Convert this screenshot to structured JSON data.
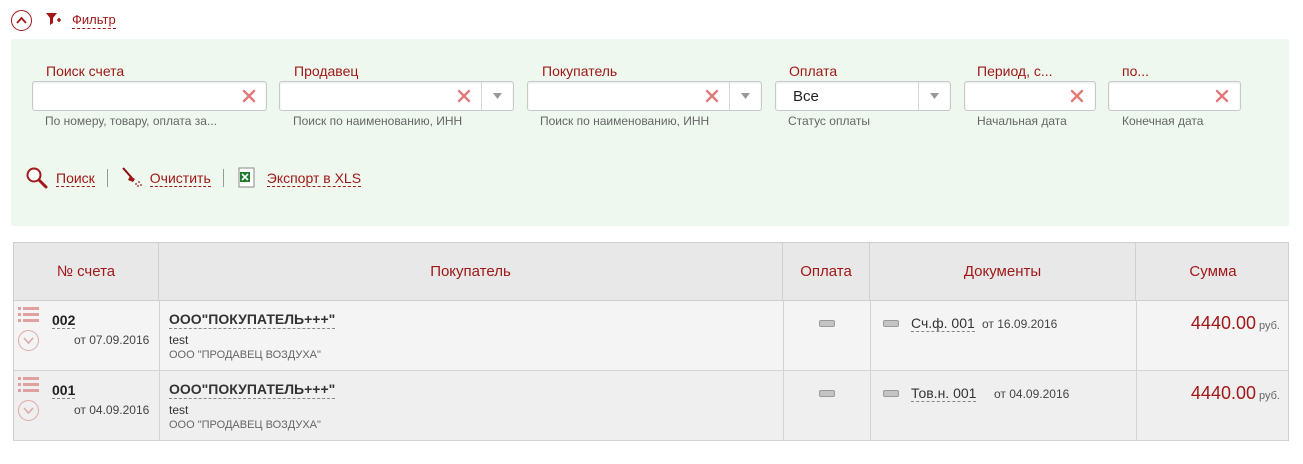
{
  "filter_toggle": {
    "label": "Фильтр"
  },
  "filters": {
    "invoice_search": {
      "label": "Поиск счета",
      "value": "",
      "hint": "По номеру, товару, оплата за..."
    },
    "seller": {
      "label": "Продавец",
      "value": "",
      "hint": "Поиск по наименованию, ИНН"
    },
    "buyer": {
      "label": "Покупатель",
      "value": "",
      "hint": "Поиск по наименованию, ИНН"
    },
    "payment": {
      "label": "Оплата",
      "value": "Все",
      "hint": "Статус оплаты"
    },
    "period_from": {
      "label": "Период, с...",
      "value": "",
      "hint": "Начальная дата"
    },
    "period_to": {
      "label": "по...",
      "value": "",
      "hint": "Конечная дата"
    }
  },
  "actions": {
    "search": "Поиск",
    "clear": "Очистить",
    "export": "Экспорт в XLS"
  },
  "table": {
    "headers": {
      "number": "№ счета",
      "buyer": "Покупатель",
      "payment": "Оплата",
      "documents": "Документы",
      "sum": "Сумма"
    },
    "rows": [
      {
        "number": "002",
        "date": "от 07.09.2016",
        "buyer": "ООО\"ПОКУПАТЕЛЬ+++\"",
        "note": "test",
        "seller": "ООО \"ПРОДАВЕЦ ВОЗДУХА\"",
        "doc": "Сч.ф. 001",
        "doc_date": "от 16.09.2016",
        "sum": "4440.00",
        "currency": "руб."
      },
      {
        "number": "001",
        "date": "от 04.09.2016",
        "buyer": "ООО\"ПОКУПАТЕЛЬ+++\"",
        "note": "test",
        "seller": "ООО \"ПРОДАВЕЦ ВОЗДУХА\"",
        "doc": "Тов.н. 001",
        "doc_date": "от 04.09.2016",
        "sum": "4440.00",
        "currency": "руб."
      }
    ]
  },
  "colors": {
    "accent": "#a01818",
    "panel_bg": "#eef8ef",
    "header_bg": "#e8e8e8"
  }
}
